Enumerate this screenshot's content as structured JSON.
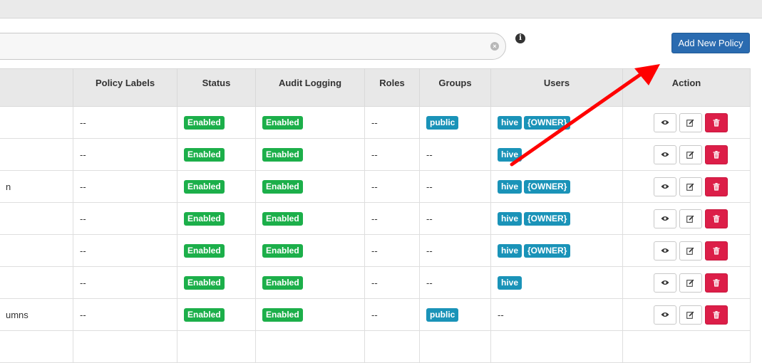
{
  "search": {
    "value": "",
    "clear_glyph": "×"
  },
  "info": {
    "glyph": "i"
  },
  "add_button": {
    "label": "Add New Policy"
  },
  "table": {
    "columns": [
      "",
      "Policy Labels",
      "Status",
      "Audit Logging",
      "Roles",
      "Groups",
      "Users",
      "Action"
    ],
    "rows": [
      {
        "name": "",
        "labels": "--",
        "status": "Enabled",
        "audit": "Enabled",
        "roles": "--",
        "groups": [
          "public"
        ],
        "groups_text": "",
        "users": [
          "hive",
          "{OWNER}"
        ],
        "users_text": ""
      },
      {
        "name": "",
        "labels": "--",
        "status": "Enabled",
        "audit": "Enabled",
        "roles": "--",
        "groups": [],
        "groups_text": "--",
        "users": [
          "hive"
        ],
        "users_text": ""
      },
      {
        "name": "n",
        "labels": "--",
        "status": "Enabled",
        "audit": "Enabled",
        "roles": "--",
        "groups": [],
        "groups_text": "--",
        "users": [
          "hive",
          "{OWNER}"
        ],
        "users_text": ""
      },
      {
        "name": "",
        "labels": "--",
        "status": "Enabled",
        "audit": "Enabled",
        "roles": "--",
        "groups": [],
        "groups_text": "--",
        "users": [
          "hive",
          "{OWNER}"
        ],
        "users_text": ""
      },
      {
        "name": "",
        "labels": "--",
        "status": "Enabled",
        "audit": "Enabled",
        "roles": "--",
        "groups": [],
        "groups_text": "--",
        "users": [
          "hive",
          "{OWNER}"
        ],
        "users_text": ""
      },
      {
        "name": "",
        "labels": "--",
        "status": "Enabled",
        "audit": "Enabled",
        "roles": "--",
        "groups": [],
        "groups_text": "--",
        "users": [
          "hive"
        ],
        "users_text": ""
      },
      {
        "name": "umns",
        "labels": "--",
        "status": "Enabled",
        "audit": "Enabled",
        "roles": "--",
        "groups": [
          "public"
        ],
        "groups_text": "",
        "users": [],
        "users_text": "--"
      },
      {
        "name": "",
        "labels": "",
        "status": "",
        "audit": "",
        "roles": "",
        "groups": [],
        "groups_text": "",
        "users": [],
        "users_text": ""
      }
    ],
    "action_icons": [
      "eye-icon",
      "edit-icon",
      "trash-icon"
    ]
  },
  "colors": {
    "primary_button": "#2a6bb0",
    "enabled_badge": "#1caf4a",
    "tag_badge": "#1a93b8",
    "delete_button": "#dc1e48",
    "annotation_arrow": "#ff0000"
  }
}
